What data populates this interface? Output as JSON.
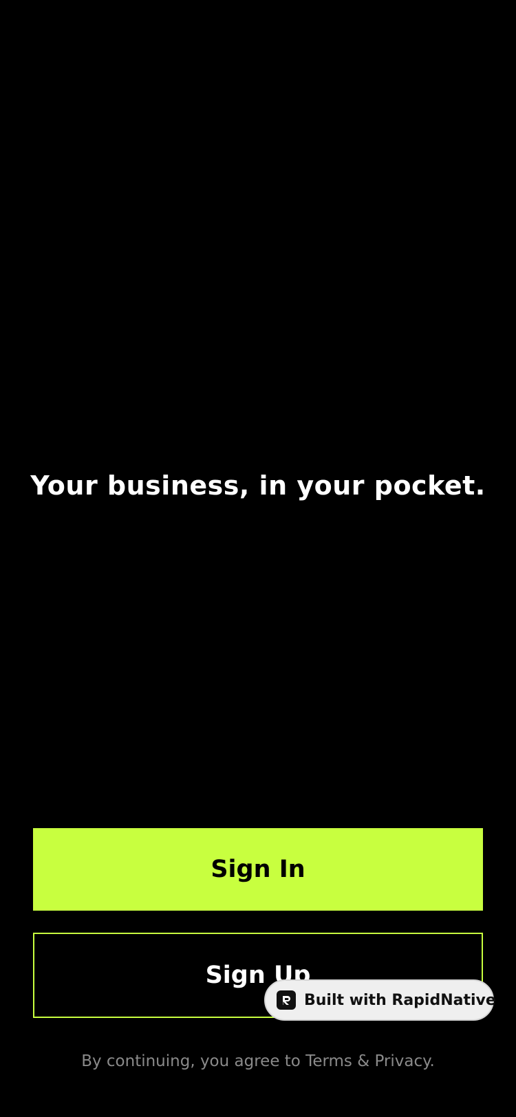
{
  "welcome": {
    "tagline": "Your business, in your pocket."
  },
  "actions": {
    "sign_in_label": "Sign In",
    "sign_up_label": "Sign Up"
  },
  "legal": {
    "text": "By continuing, you agree to Terms & Privacy."
  },
  "badge": {
    "label": "Built with RapidNative",
    "icon": "rapidnative-logo-icon"
  },
  "colors": {
    "background": "#000000",
    "accent": "#c8ff3f",
    "primary_text": "#ffffff",
    "muted_text": "#8a8a8a",
    "badge_background": "#efefef"
  }
}
